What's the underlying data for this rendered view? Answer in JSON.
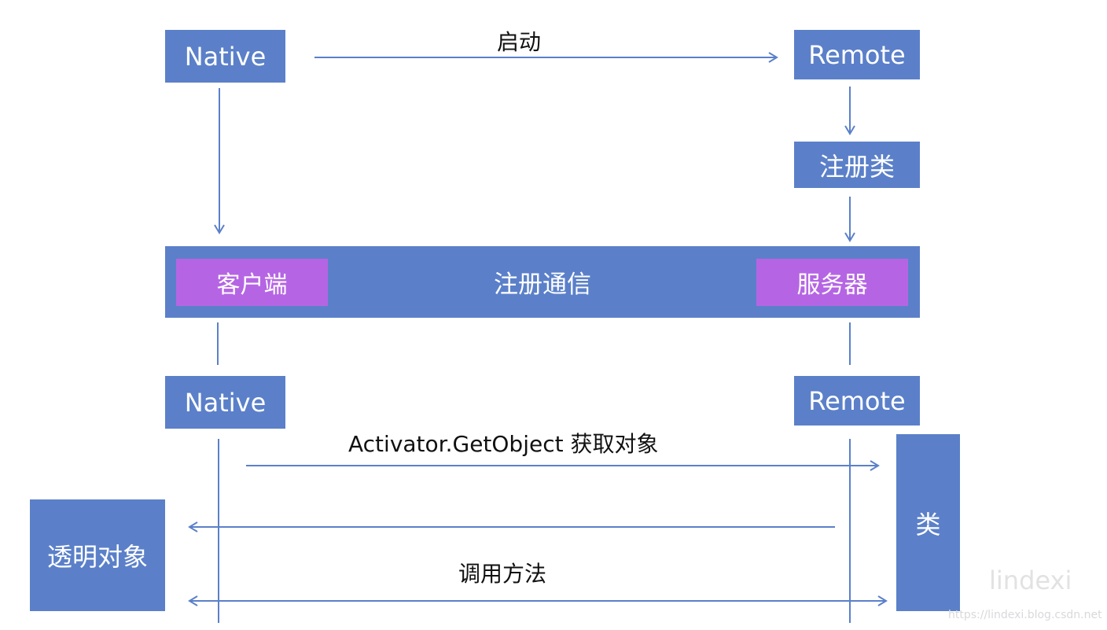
{
  "colors": {
    "box": "#5b80c9",
    "sub": "#b565e3",
    "line": "#5b80c9",
    "text": "#111111"
  },
  "nodes": {
    "native_top": "Native",
    "remote_top": "Remote",
    "register_class": "注册类",
    "register_comm": "注册通信",
    "client": "客户端",
    "server": "服务器",
    "native_bottom": "Native",
    "remote_bottom": "Remote",
    "class_box": "类",
    "transparent_object": "透明对象"
  },
  "edges": {
    "start_label": "启动",
    "get_object_label": "Activator.GetObject 获取对象",
    "call_method_label": "调用方法"
  },
  "watermark": {
    "name": "lindexi",
    "url": "https://lindexi.blog.csdn.net"
  }
}
